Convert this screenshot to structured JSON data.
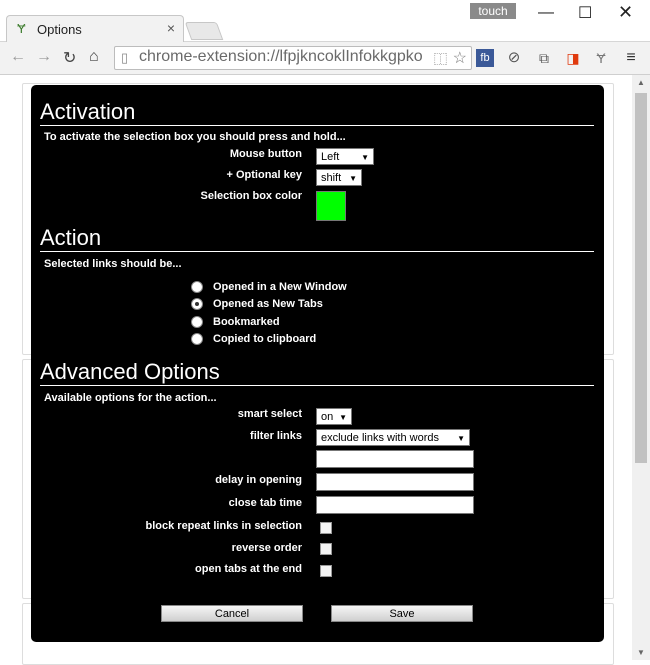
{
  "browser": {
    "tab_title": "Options",
    "tab_close": "×",
    "touch_label": "touch",
    "url": "chrome-extension://lfpjkncoklInfokkgpko",
    "extensions": [
      "fb"
    ]
  },
  "activation": {
    "title": "Activation",
    "description": "To activate the selection box you should press and hold...",
    "mouse_button_label": "Mouse button",
    "mouse_button_value": "Left",
    "optional_key_label": "+ Optional key",
    "optional_key_value": "shift",
    "color_label": "Selection box color",
    "color_value": "#00ff00"
  },
  "action": {
    "title": "Action",
    "description": "Selected links should be...",
    "options": [
      {
        "label": "Opened in a New Window",
        "selected": false
      },
      {
        "label": "Opened as New Tabs",
        "selected": true
      },
      {
        "label": "Bookmarked",
        "selected": false
      },
      {
        "label": "Copied to clipboard",
        "selected": false
      }
    ]
  },
  "advanced": {
    "title": "Advanced Options",
    "description": "Available options for the action...",
    "smart_select_label": "smart select",
    "smart_select_value": "on",
    "filter_links_label": "filter links",
    "filter_links_value": "exclude links with words",
    "filter_words_value": "",
    "delay_label": "delay in opening",
    "delay_value": "",
    "close_tab_label": "close tab time",
    "close_tab_value": "",
    "block_repeat_label": "block repeat links in selection",
    "reverse_order_label": "reverse order",
    "open_at_end_label": "open tabs at the end"
  },
  "buttons": {
    "cancel": "Cancel",
    "save": "Save"
  }
}
